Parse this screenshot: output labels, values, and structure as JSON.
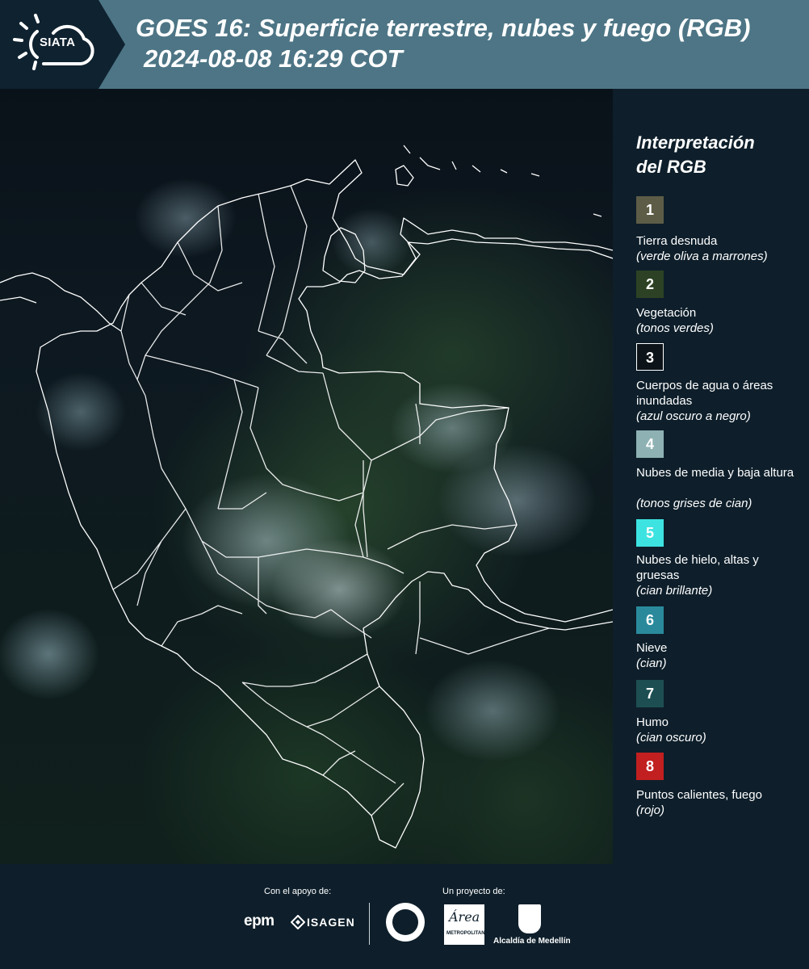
{
  "header": {
    "logo_text": "SIATA",
    "title": "GOES 16: Superficie terrestre, nubes y fuego (RGB)",
    "subtitle": "2024-08-08 16:29 COT"
  },
  "legend": {
    "title_line1": "Interpretación",
    "title_line2": "del RGB",
    "items": [
      {
        "number": "1",
        "name": "Tierra desnuda",
        "note": "(verde oliva a marrones)",
        "color": "#5d5c46"
      },
      {
        "number": "2",
        "name": "Vegetación",
        "note": "(tonos verdes)",
        "color": "#2d4224"
      },
      {
        "number": "3",
        "name": "Cuerpos de agua o áreas inundadas",
        "note": "(azul oscuro a negro)",
        "color": "#0c1419"
      },
      {
        "number": "4",
        "name": "Nubes de media y baja altura",
        "note": "(tonos grises de cian)",
        "color": "#8eb2b3"
      },
      {
        "number": "5",
        "name": "Nubes de hielo, altas y gruesas",
        "note": "(cian brillante)",
        "color": "#3de3e1"
      },
      {
        "number": "6",
        "name": "Nieve",
        "note": "(cian)",
        "color": "#2a8a9c"
      },
      {
        "number": "7",
        "name": "Humo",
        "note": "(cian oscuro)",
        "color": "#1d4f52"
      },
      {
        "number": "8",
        "name": "Puntos calientes, fuego",
        "note": "(rojo)",
        "color": "#c21f20"
      }
    ]
  },
  "footer": {
    "support_label": "Con el apoyo de:",
    "project_label": "Un proyecto de:",
    "epm": "epm",
    "isagen": "ISAGEN",
    "amva_script": "Área",
    "amva_text": "METROPOLITANA",
    "medellin": "Alcaldía de Medellín"
  }
}
